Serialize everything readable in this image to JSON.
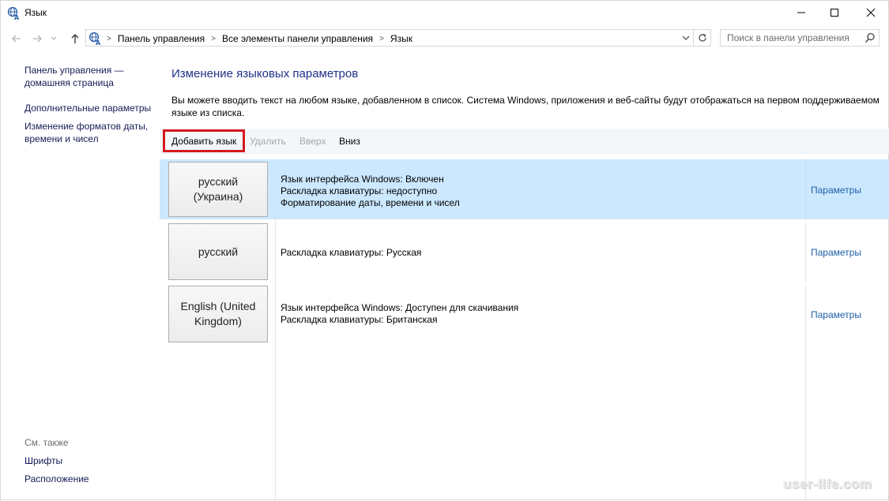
{
  "window": {
    "title": "Язык",
    "icon": "language-icon",
    "controls": [
      "minimize-icon",
      "maximize-icon",
      "close-icon"
    ]
  },
  "nav": {
    "back_icon": "arrow-left-icon",
    "forward_icon": "arrow-right-icon",
    "recent_icon": "chevron-down-icon",
    "up_icon": "arrow-up-icon",
    "breadcrumb": [
      "Панель управления",
      "Все элементы панели управления",
      "Язык"
    ],
    "refresh_icon": "refresh-icon",
    "search_placeholder": "Поиск в панели управления"
  },
  "sidebar": {
    "home_line1": "Панель управления —",
    "home_line2": "домашняя страница",
    "advanced": "Дополнительные параметры",
    "formats_line1": "Изменение форматов даты,",
    "formats_line2": "времени и чисел",
    "see_also": "См. также",
    "fonts": "Шрифты",
    "location": "Расположение"
  },
  "main": {
    "title": "Изменение языковых параметров",
    "desc_line1": "Вы можете вводить текст на любом языке, добавленном в список. Система Windows, приложения и веб-сайты будут отображаться на первом поддерживаемом",
    "desc_line2": "языке из списка."
  },
  "toolbar": {
    "add": "Добавить язык",
    "remove": "Удалить",
    "up": "Вверх",
    "down": "Вниз"
  },
  "languages": [
    {
      "name_line1": "русский",
      "name_line2": "(Украина)",
      "selected": true,
      "info": [
        "Язык интерфейса Windows: Включен",
        "Раскладка клавиатуры: недоступно",
        "Форматирование даты, времени и чисел"
      ],
      "options": "Параметры"
    },
    {
      "name_line1": "русский",
      "name_line2": "",
      "selected": false,
      "info": [
        "Раскладка клавиатуры: Русская"
      ],
      "options": "Параметры"
    },
    {
      "name_line1": "English (United",
      "name_line2": "Kingdom)",
      "selected": false,
      "info": [
        "Язык интерфейса Windows: Доступен для скачивания",
        "Раскладка клавиатуры: Британская"
      ],
      "options": "Параметры"
    }
  ],
  "watermark": "user-life.com",
  "colors": {
    "selected_row": "#cce8ff",
    "link": "#1e5fa8",
    "title": "#1e3287",
    "highlight_border": "#d4181f"
  }
}
